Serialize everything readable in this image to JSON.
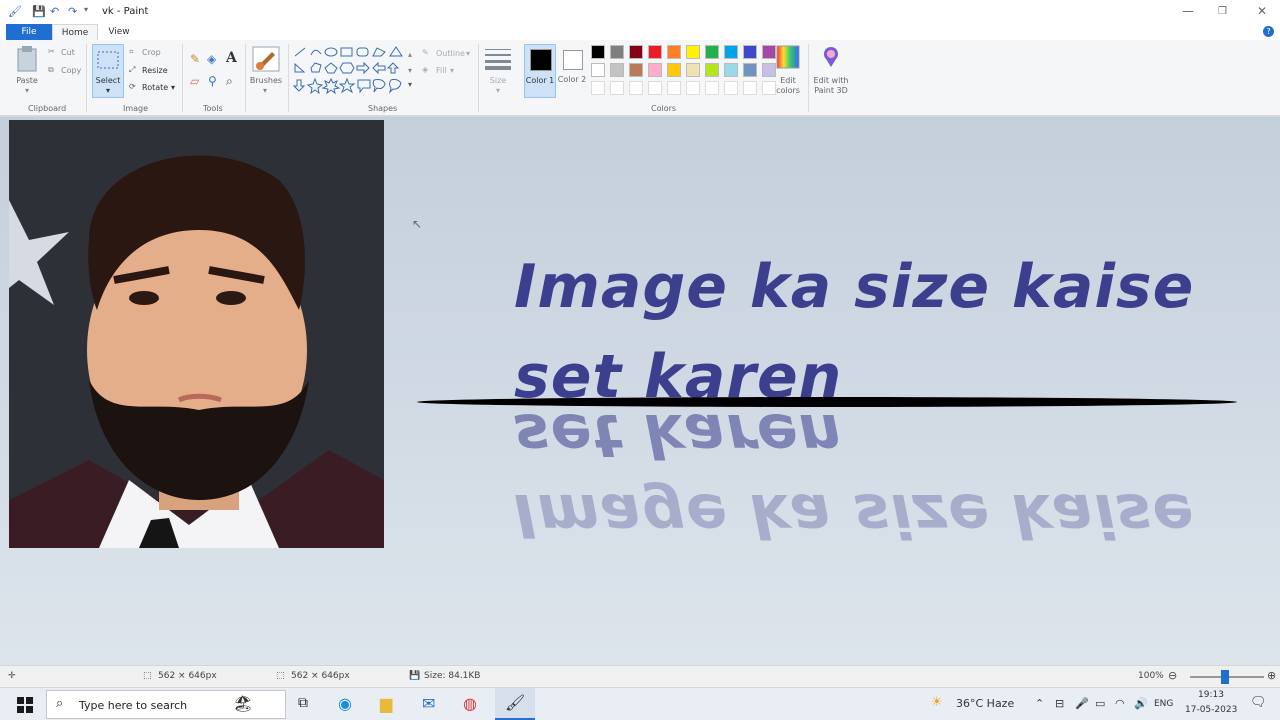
{
  "window": {
    "title": "vk - Paint"
  },
  "tabs": {
    "file": "File",
    "home": "Home",
    "view": "View"
  },
  "ribbon": {
    "clipboard": {
      "paste": "Paste",
      "cut": "Cut",
      "copy": "Copy",
      "label": "Clipboard"
    },
    "image": {
      "select": "Select",
      "crop": "Crop",
      "resize": "Resize",
      "rotate": "Rotate",
      "label": "Image"
    },
    "tools": {
      "label": "Tools"
    },
    "brushes": {
      "label": "Brushes"
    },
    "shapes": {
      "outline": "Outline",
      "fill": "Fill",
      "label": "Shapes"
    },
    "size": {
      "label": "Size"
    },
    "colors": {
      "color1": "Color 1",
      "color2": "Color 2",
      "edit_colors": "Edit colors",
      "edit_paint3d": "Edit with Paint 3D",
      "label": "Colors",
      "palette_row1": [
        "#000000",
        "#7f7f7f",
        "#880015",
        "#ed1c24",
        "#ff7f27",
        "#fff200",
        "#22b14c",
        "#00a2e8",
        "#3f48cc",
        "#a349a4"
      ],
      "palette_row2": [
        "#ffffff",
        "#c3c3c3",
        "#b97a57",
        "#ffaec9",
        "#ffc90e",
        "#efe4b0",
        "#b5e61d",
        "#99d9ea",
        "#7092be",
        "#c8bfe7"
      ]
    }
  },
  "canvas": {
    "headline_line1": "Image ka size kaise",
    "headline_line2": "set karen",
    "text_color": "#3c3f8e",
    "accent_color": "#e0407a"
  },
  "status": {
    "selection_size": "562 × 646px",
    "image_size": "562 × 646px",
    "file_size": "Size: 84.1KB",
    "zoom": "100%"
  },
  "taskbar": {
    "search_placeholder": "Type here to search",
    "weather": "36°C Haze",
    "lang": "ENG",
    "time": "19:13",
    "date": "17-05-2023"
  }
}
